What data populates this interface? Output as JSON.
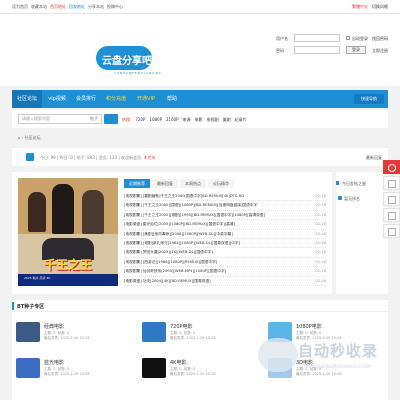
{
  "topbar": {
    "left": [
      "设为首页",
      "收藏本站",
      "首页地址",
      "回发地址",
      "分享本站",
      "投稿中心"
    ],
    "right_red": "繁體中文",
    "right": "切换风格"
  },
  "logo": {
    "text": "云盘分享吧",
    "sub": "YUNPANFENXIANGBA"
  },
  "login": {
    "username_label": "用户名",
    "password_label": "密码",
    "remember_label": "自动登录",
    "forgot_link": "找回密码",
    "login_button": "登录",
    "register_link": "立即注册"
  },
  "nav": {
    "items": [
      "社区论坛",
      "vip视频",
      "会员排行",
      "积分充值",
      "开通VIP",
      "帮助"
    ],
    "search_button": "快速导航"
  },
  "search": {
    "placeholder": "请输入搜索内容",
    "select": "帖子",
    "hot": [
      "热搜:",
      "720P",
      "1080P",
      "2160P",
      "来源",
      "电影",
      "电视剧",
      "美剧",
      "纪录片"
    ]
  },
  "breadcrumb": "⌂ › 社区论坛",
  "stats": {
    "text": "今日: 99 | 昨日: 0 | 帖子: 883 | 会员: 123 | 欢迎新会员:",
    "new_member": "木芒灰",
    "more": "最新回复"
  },
  "poster": {
    "title": "千王之王",
    "tag": "2025 新片 高清 4K"
  },
  "tabs": [
    "近期推荐",
    "最新回复",
    "本周热点",
    "论坛精华"
  ],
  "list": [
    {
      "title": "[电视剧集] [喜剧幽默]千王之王2000[国语中字]BD-REMUX[4K]DTS-HD",
      "date": "02-16"
    },
    {
      "title": "[电视剧集] [千王之王2000][国语][1080P][BD-REMUX][百度网盘链接]国语中字",
      "date": "02-16"
    },
    {
      "title": "[电视剧集] [千王之王2000][港剧][1995][BD-REMUX][国语中字][1080P][高清双语]",
      "date": "02-16"
    },
    {
      "title": "[电影原盘] 星光灿烂[2005][1080P][BD-REMUX][国语中字][高清]",
      "date": "02-16"
    },
    {
      "title": "[电视剧集] [美剧][绝命毒师][2008][1080P][WEB-DL][中英字幕]",
      "date": "02-16"
    },
    {
      "title": "[电视剧集] [港剧]新扎师兄[1984][1080P][WEB-DL][国粤双语][中字]",
      "date": "02-16"
    },
    {
      "title": "[电视剧集] 梦回大唐[2025][4K][WEB-DL][国语中字]",
      "date": "02-16"
    },
    {
      "title": "[电视剧集] [西游记][1986][1080P][REMUX][国语中字]",
      "date": "02-16"
    },
    {
      "title": "[电视剧集] 仙剑奇侠传[2005][WEB-MP4][1080P][国语中字]",
      "date": "02-16"
    },
    {
      "title": "[电影原盘] 功夫[2004][4K][BD-REMUX][国粤双语]",
      "date": "02-16"
    }
  ],
  "side": {
    "title": "今日发帖之星",
    "item": "暂无排名"
  },
  "bt": {
    "title": "BT种子专区",
    "cards": [
      {
        "name": "经典电影",
        "meta": "主题: 0, 帖数: 0",
        "meta2": "最后发表: 2025-1-29 15:28",
        "color": "#3a5b86"
      },
      {
        "name": "720P电影",
        "meta": "主题: 0, 帖数: 0",
        "meta2": "最后发表: 2025-1-29 15:28",
        "color": "#2f7ac4"
      },
      {
        "name": "1080P电影",
        "meta": "主题: 0, 帖数: 0",
        "meta2": "最后发表: 2025-1-29 15:28",
        "color": "#5ab5e8"
      },
      {
        "name": "蓝光电影",
        "meta": "主题: 0, 帖数: 0",
        "meta2": "最后发表: 2025-1-29 15:28",
        "color": "#3b6cc2"
      },
      {
        "name": "4K电影",
        "meta": "主题: 0, 帖数: 0",
        "meta2": "最后发表: 2025-1-29 15:28",
        "color": "#111111"
      },
      {
        "name": "3D电影",
        "meta": "主题: 0, 帖数: 0",
        "meta2": "最后发表: 2025-1-29 15:28",
        "color": "#a3c8ea"
      }
    ]
  },
  "watermark": {
    "text": "自动秒收录",
    "sub": "WWW.ZIDONGMIAOSHOULU.COM"
  }
}
